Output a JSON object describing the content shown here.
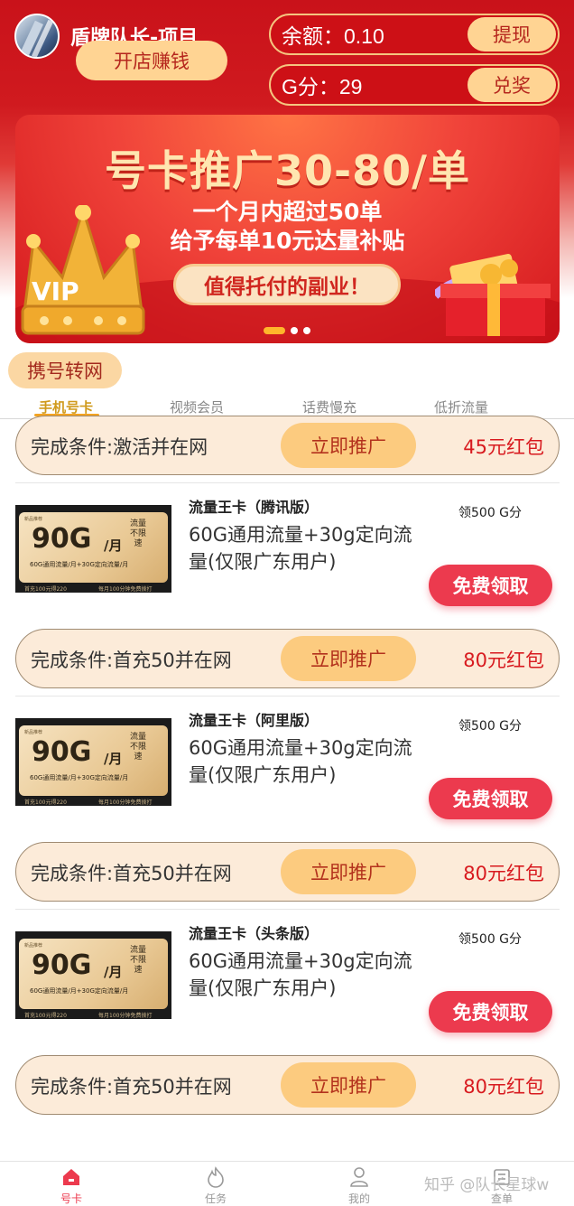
{
  "header": {
    "username": "盾牌队长-项目",
    "open_shop_label": "开店赚钱",
    "balance_label": "余额：0.10",
    "withdraw_label": "提现",
    "points_label": "G分：29",
    "redeem_label": "兑奖"
  },
  "banner": {
    "title": "号卡推广30-80/单",
    "line1": "一个月内超过50单",
    "line2": "给予每单10元达量补贴",
    "pill": "值得托付的副业！",
    "crown_text": "VIP",
    "dots": 3,
    "active_dot": 0
  },
  "section": {
    "title": "携号转网"
  },
  "tabs": [
    {
      "label": "手机号卡",
      "active": true
    },
    {
      "label": "视频会员",
      "active": false
    },
    {
      "label": "话费慢充",
      "active": false
    },
    {
      "label": "低折流量",
      "active": false
    }
  ],
  "promo_button_label": "立即推广",
  "claim_button_label": "免费领取",
  "product_image": {
    "big": "90G",
    "unit": "/月",
    "unit2": "流量",
    "tag": "不限速",
    "line": "60G通用流量/月+30G定向流量/月",
    "foot_left": "首充100元得220",
    "foot_right": "每月100分钟免费拨打",
    "corner": "新品推荐"
  },
  "conditions": [
    {
      "text": "完成条件:激活并在网",
      "reward": "45元红包"
    },
    {
      "text": "完成条件:首充50并在网",
      "reward": "80元红包"
    },
    {
      "text": "完成条件:首充50并在网",
      "reward": "80元红包"
    },
    {
      "text": "完成条件:首充50并在网",
      "reward": "80元红包"
    }
  ],
  "products": [
    {
      "name": "流量王卡（腾讯版）",
      "desc": "60G通用流量+30g定向流量(仅限广东用户)",
      "points": "领500 G分"
    },
    {
      "name": "流量王卡（阿里版）",
      "desc": "60G通用流量+30g定向流量(仅限广东用户)",
      "points": "领500 G分"
    },
    {
      "name": "流量王卡（头条版）",
      "desc": "60G通用流量+30g定向流量(仅限广东用户)",
      "points": "领500 G分"
    }
  ],
  "bottom_nav": [
    {
      "label": "号卡",
      "icon": "home-icon",
      "active": true
    },
    {
      "label": "任务",
      "icon": "flame-icon",
      "active": false
    },
    {
      "label": "我的",
      "icon": "user-icon",
      "active": false
    },
    {
      "label": "查单",
      "icon": "order-icon",
      "active": false
    }
  ],
  "watermark": "知乎 @队长星球w",
  "colors": {
    "brand_red": "#cd1016",
    "accent_gold": "#ffd493",
    "claim_red": "#ec3a4e",
    "reward_red": "#d81a1f"
  }
}
